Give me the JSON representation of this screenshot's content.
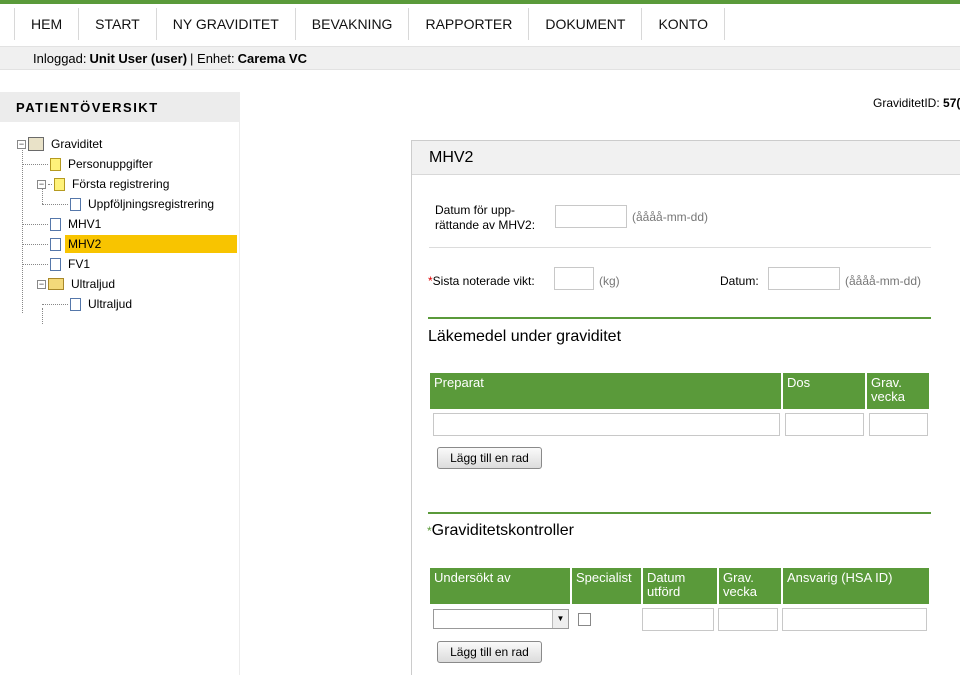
{
  "nav": {
    "items": [
      "HEM",
      "START",
      "NY GRAVIDITET",
      "BEVAKNING",
      "RAPPORTER",
      "DOKUMENT",
      "KONTO"
    ]
  },
  "login": {
    "prefix": "Inloggad:",
    "user": "Unit User (user)",
    "sep": "| Enhet:",
    "unit": "Carema VC"
  },
  "sidebar": {
    "title": "PATIENTÖVERSIKT",
    "tree": [
      {
        "label": "Graviditet"
      },
      {
        "label": "Personuppgifter"
      },
      {
        "label": "Första registrering"
      },
      {
        "label": "Uppföljningsregistrering"
      },
      {
        "label": "MHV1"
      },
      {
        "label": "MHV2"
      },
      {
        "label": "FV1"
      },
      {
        "label": "Ultraljud"
      },
      {
        "label": "Ultraljud"
      }
    ]
  },
  "graviditet_id": {
    "label": "GraviditetID:",
    "value": "57("
  },
  "panel": {
    "title": "MHV2",
    "datum_label_1": "Datum för upp-",
    "datum_label_2": "rättande av MHV2:",
    "datum_hint": "(åååå-mm-dd)",
    "req_mark": "*",
    "vikt_label": "Sista noterade vikt:",
    "vikt_hint": "(kg)",
    "datum2_label": "Datum:",
    "datum2_hint": "(åååå-mm-dd)",
    "lakemedel_title": "Läkemedel under graviditet",
    "lakemedel_cols": [
      "Preparat",
      "Dos",
      "Grav. vecka"
    ],
    "add_row_label": "Lägg till en rad",
    "kontroller_title": "Graviditetskontroller",
    "kontroller_cols": [
      "Undersökt av",
      "Specialist",
      "Datum utförd",
      "Grav. vecka",
      "Ansvarig (HSA ID)"
    ]
  }
}
